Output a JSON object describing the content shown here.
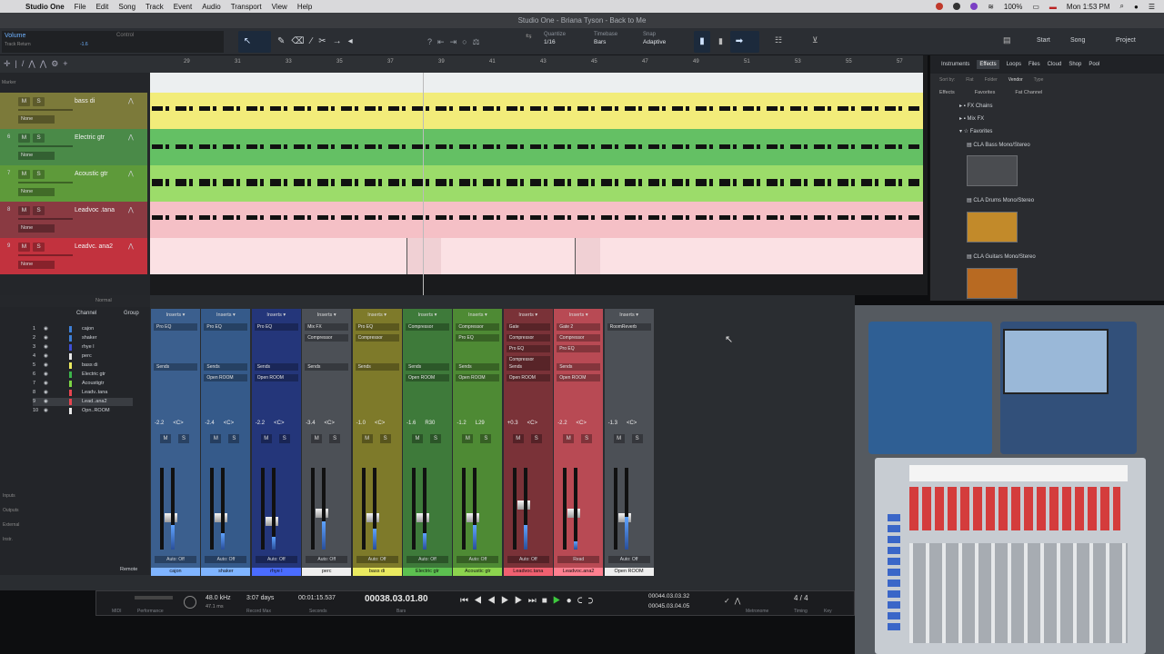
{
  "menubar": {
    "app": "Studio One",
    "items": [
      "File",
      "Edit",
      "Song",
      "Track",
      "Event",
      "Audio",
      "Transport",
      "View",
      "Help"
    ],
    "battery": "100%",
    "clock": "Mon 1:53 PM"
  },
  "window_title": "Studio One - Briana Tyson - Back to Me",
  "toolbar": {
    "param": "Volume",
    "param_label": "Track Return",
    "param_val": "-1.6",
    "control": "Control",
    "quantize_label": "Quantize",
    "quantize_val": "1/16",
    "timebase_label": "Timebase",
    "timebase_val": "Bars",
    "snap_label": "Snap",
    "snap_val": "Adaptive",
    "start": "Start",
    "song": "Song",
    "project": "Project"
  },
  "ruler": [
    "29",
    "31",
    "33",
    "35",
    "37",
    "39",
    "41",
    "43",
    "45",
    "47",
    "49",
    "51",
    "53",
    "55",
    "57"
  ],
  "tracks": [
    {
      "num": "",
      "name": "bass di",
      "color": "#7c7a3a",
      "lane": "#f2ec7a",
      "sel": "None"
    },
    {
      "num": "6",
      "name": "Electric gtr",
      "color": "#4a8a48",
      "lane": "#64c064",
      "sel": "None"
    },
    {
      "num": "7",
      "name": "Acoustic gtr",
      "color": "#5e9a3a",
      "lane": "#9cdc6a",
      "sel": "None"
    },
    {
      "num": "8",
      "name": "Leadvoc .tana",
      "color": "#8a3a42",
      "lane": "#f5c0c6",
      "sel": "None"
    },
    {
      "num": "9",
      "name": "Leadvc. ana2",
      "color": "#c2323e",
      "lane": "#fbe1e4",
      "sel": "None"
    }
  ],
  "browser": {
    "tabs": [
      "Instruments",
      "Effects",
      "Loops",
      "Files",
      "Cloud",
      "Shop",
      "Pool"
    ],
    "filters": [
      "Sort by:",
      "Flat",
      "Folder",
      "Vendor",
      "Type"
    ],
    "crumbs": [
      "Effects",
      "Favorites",
      "Fat Channel"
    ],
    "items": [
      "FX Chains",
      "Mix FX",
      "Favorites",
      "CLA Bass Mono/Stereo",
      "CLA Drums Mono/Stereo",
      "CLA Guitars Mono/Stereo"
    ]
  },
  "chanlist": {
    "header_channel": "Channel",
    "header_group": "Group",
    "items": [
      {
        "num": "1",
        "name": "cajon",
        "color": "#3e7fd6"
      },
      {
        "num": "2",
        "name": "shaker",
        "color": "#3e7fd6"
      },
      {
        "num": "3",
        "name": "rhye l",
        "color": "#3e4fd6"
      },
      {
        "num": "4",
        "name": "perc",
        "color": "#e8e8e8"
      },
      {
        "num": "5",
        "name": "bass di",
        "color": "#eaea60"
      },
      {
        "num": "6",
        "name": "Electric gtr",
        "color": "#3cb44a"
      },
      {
        "num": "7",
        "name": "Acoustigtr",
        "color": "#7cd444"
      },
      {
        "num": "8",
        "name": "Leadv..tana",
        "color": "#e64550"
      },
      {
        "num": "9",
        "name": "Lead..ana2",
        "color": "#e64550"
      },
      {
        "num": "10",
        "name": "Opn..ROOM",
        "color": "#e8e8e8"
      }
    ],
    "side": [
      "Inputs",
      "Outputs",
      "External",
      "Instr."
    ],
    "normal": "Normal",
    "remote": "Remote"
  },
  "channels": [
    {
      "name": "cajon",
      "color": "#3b5f8e",
      "namebg": "#7fb4ff",
      "vol": "-2.2",
      "pan": "<C>",
      "fx": [
        "Pro EQ"
      ],
      "sends": [
        "Sends"
      ],
      "auto": "Auto: Off",
      "meter": 0.3,
      "fader": 0.45
    },
    {
      "name": "shaker",
      "color": "#355a8a",
      "namebg": "#7fb4ff",
      "vol": "-2.4",
      "pan": "<C>",
      "fx": [
        "Pro EQ"
      ],
      "sends": [
        "Sends",
        "Open ROOM"
      ],
      "auto": "Auto: Off",
      "meter": 0.2,
      "fader": 0.45
    },
    {
      "name": "rhye l",
      "color": "#24367a",
      "namebg": "#4a6cff",
      "vol": "-2.2",
      "pan": "<C>",
      "fx": [
        "Pro EQ"
      ],
      "sends": [
        "Sends",
        "Open ROOM"
      ],
      "auto": "Auto: Off",
      "meter": 0.15,
      "fader": 0.4
    },
    {
      "name": "perc",
      "color": "#4c5056",
      "namebg": "#eeeeee",
      "vol": "-3.4",
      "pan": "<C>",
      "fx": [
        "Mix FX",
        "Compressor"
      ],
      "sends": [
        "Sends"
      ],
      "auto": "Auto: Off",
      "meter": 0.35,
      "fader": 0.5
    },
    {
      "name": "bass di",
      "color": "#7e7a2a",
      "namebg": "#eaea60",
      "vol": "-1.0",
      "pan": "<C>",
      "fx": [
        "Pro EQ",
        "Compressor"
      ],
      "sends": [
        "Sends"
      ],
      "auto": "Auto: Off",
      "meter": 0.25,
      "fader": 0.45
    },
    {
      "name": "Electric gtr",
      "color": "#3e7a3a",
      "namebg": "#5cc050",
      "vol": "-1.6",
      "pan": "R30",
      "fx": [
        "Compressor"
      ],
      "sends": [
        "Sends",
        "Open ROOM"
      ],
      "auto": "Auto: Off",
      "meter": 0.2,
      "fader": 0.45
    },
    {
      "name": "Acoustic gtr",
      "color": "#4e8a34",
      "namebg": "#8cd44e",
      "vol": "-1.2",
      "pan": "L29",
      "fx": [
        "Compressor",
        "Pro EQ"
      ],
      "sends": [
        "Sends",
        "Open ROOM"
      ],
      "auto": "Auto: Off",
      "meter": 0.3,
      "fader": 0.45
    },
    {
      "name": "Leadvoc.tana",
      "color": "#7a3238",
      "namebg": "#f06070",
      "vol": "+0.3",
      "pan": "<C>",
      "fx": [
        "Gate",
        "Compressor",
        "Pro EQ",
        "Compressor"
      ],
      "sends": [
        "Sends",
        "Open ROOM"
      ],
      "auto": "Auto: Off",
      "meter": 0.3,
      "fader": 0.6
    },
    {
      "name": "Leadvoc.ana2",
      "color": "#b84a54",
      "namebg": "#ff8090",
      "vol": "-2.2",
      "pan": "<C>",
      "fx": [
        "Gate 2",
        "Compressor",
        "Pro EQ"
      ],
      "sends": [
        "Sends",
        "Open ROOM"
      ],
      "auto": "Read",
      "meter": 0.1,
      "fader": 0.5
    },
    {
      "name": "Open ROOM",
      "color": "#4c5056",
      "namebg": "#eeeeee",
      "vol": "-1.3",
      "pan": "<C>",
      "fx": [
        "RoomReverb"
      ],
      "sends": [],
      "auto": "Auto: Off",
      "meter": 0.4,
      "fader": 0.45
    }
  ],
  "transport": {
    "midi": "MIDI",
    "performance": "Performance",
    "rate": "48.0 kHz",
    "rate2": "47.1 ms",
    "rec_days": "3:07 days",
    "rec_label": "Record Max",
    "seconds": "00:01:15.537",
    "seconds_label": "Seconds",
    "bars": "00038.03.01.80",
    "bars_label": "Bars",
    "loop_l": "00044.03.03.32",
    "loop_r": "00045.03.04.05",
    "meter": "4 / 4",
    "metronome_label": "Metronome",
    "timing_label": "Timing",
    "key_label": "Key"
  }
}
